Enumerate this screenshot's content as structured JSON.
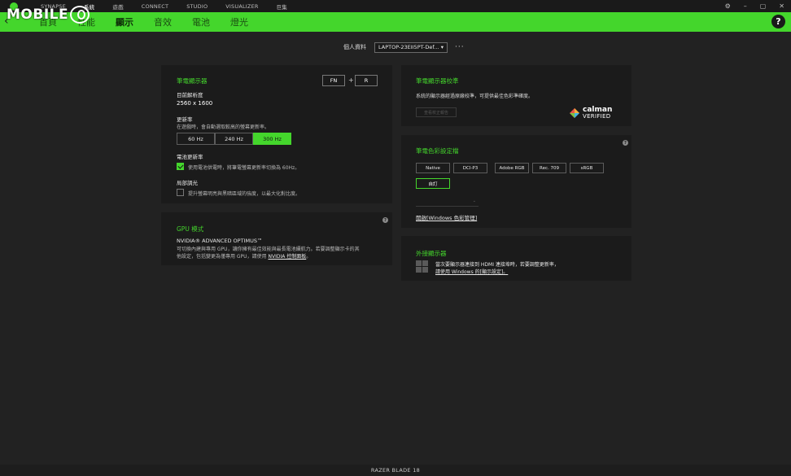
{
  "topnav": {
    "items": [
      "SYNAPSE",
      "系統",
      "遊戲",
      "CONNECT",
      "STUDIO",
      "VISUALIZER",
      "巨集"
    ],
    "active_index": 1
  },
  "watermark": {
    "text": "MOBILE"
  },
  "subnav": {
    "tabs": [
      "首頁",
      "性能",
      "顯示",
      "音效",
      "電池",
      "燈光"
    ],
    "active_index": 2,
    "help_label": "?"
  },
  "profile": {
    "label": "個人資料",
    "selected": "LAPTOP-23EII5PT-Def...",
    "more": "···"
  },
  "laptop_display": {
    "title": "筆電顯示器",
    "shortcut_keys": [
      "FN",
      "R"
    ],
    "shortcut_plus": "+",
    "resolution_label": "目前解析度",
    "resolution_value": "2560 x 1600",
    "refresh_label": "更新率",
    "refresh_desc": "在遊戲時，會自動選取較高的螢幕更新率。",
    "refresh_options": [
      "60 Hz",
      "240 Hz",
      "300 Hz"
    ],
    "refresh_selected_index": 2,
    "battery_refresh_label": "電池更新率",
    "battery_refresh_desc": "使用電池供電時，將筆電螢幕更新率切換為 60Hz。",
    "battery_refresh_checked": true,
    "local_dimming_label": "局部調光",
    "local_dimming_desc": "提升螢幕明亮與黑暗區域的強度，以最大化對比度。",
    "local_dimming_checked": false
  },
  "gpu_mode": {
    "title": "GPU 模式",
    "help_label": "?",
    "subtitle": "NVIDIA® ADVANCED OPTIMUS™",
    "desc_line1": "可切換內建與專用 GPU，讓你擁有最佳效能與最長電池續航力。若要調整顯示卡的其",
    "desc_line2": "他設定，包括變更為僅專用 GPU，請使用 ",
    "link": "NVIDIA 控制面板",
    "desc_end": "。"
  },
  "calibration": {
    "title": "筆電顯示器校準",
    "desc": "系統的顯示器經過原廠校準，可提供最佳色彩準確度。",
    "button": "查看校正報告",
    "calman_top": "calman",
    "calman_bottom": "VERIFIED"
  },
  "color_profile": {
    "title": "筆電色彩設定檔",
    "help_label": "?",
    "options": [
      "Native",
      "DCI-P3",
      "Adobe RGB",
      "Rec. 709",
      "sRGB",
      "自訂"
    ],
    "selected_index": 5,
    "dropdown_arrow": "⌄",
    "link": "開啟[Windows 色彩管理]"
  },
  "external_display": {
    "title": "外接顯示器",
    "desc_line1": "當次要顯示器連接到 HDMI 連接埠時，若要調整更新率，",
    "desc_line2": "請使用 Windows 的[顯示設定]。"
  },
  "footer": {
    "device": "RAZER BLADE 18"
  },
  "colors": {
    "accent": "#44d62c",
    "background": "#222222",
    "card": "#1b1b1b"
  }
}
